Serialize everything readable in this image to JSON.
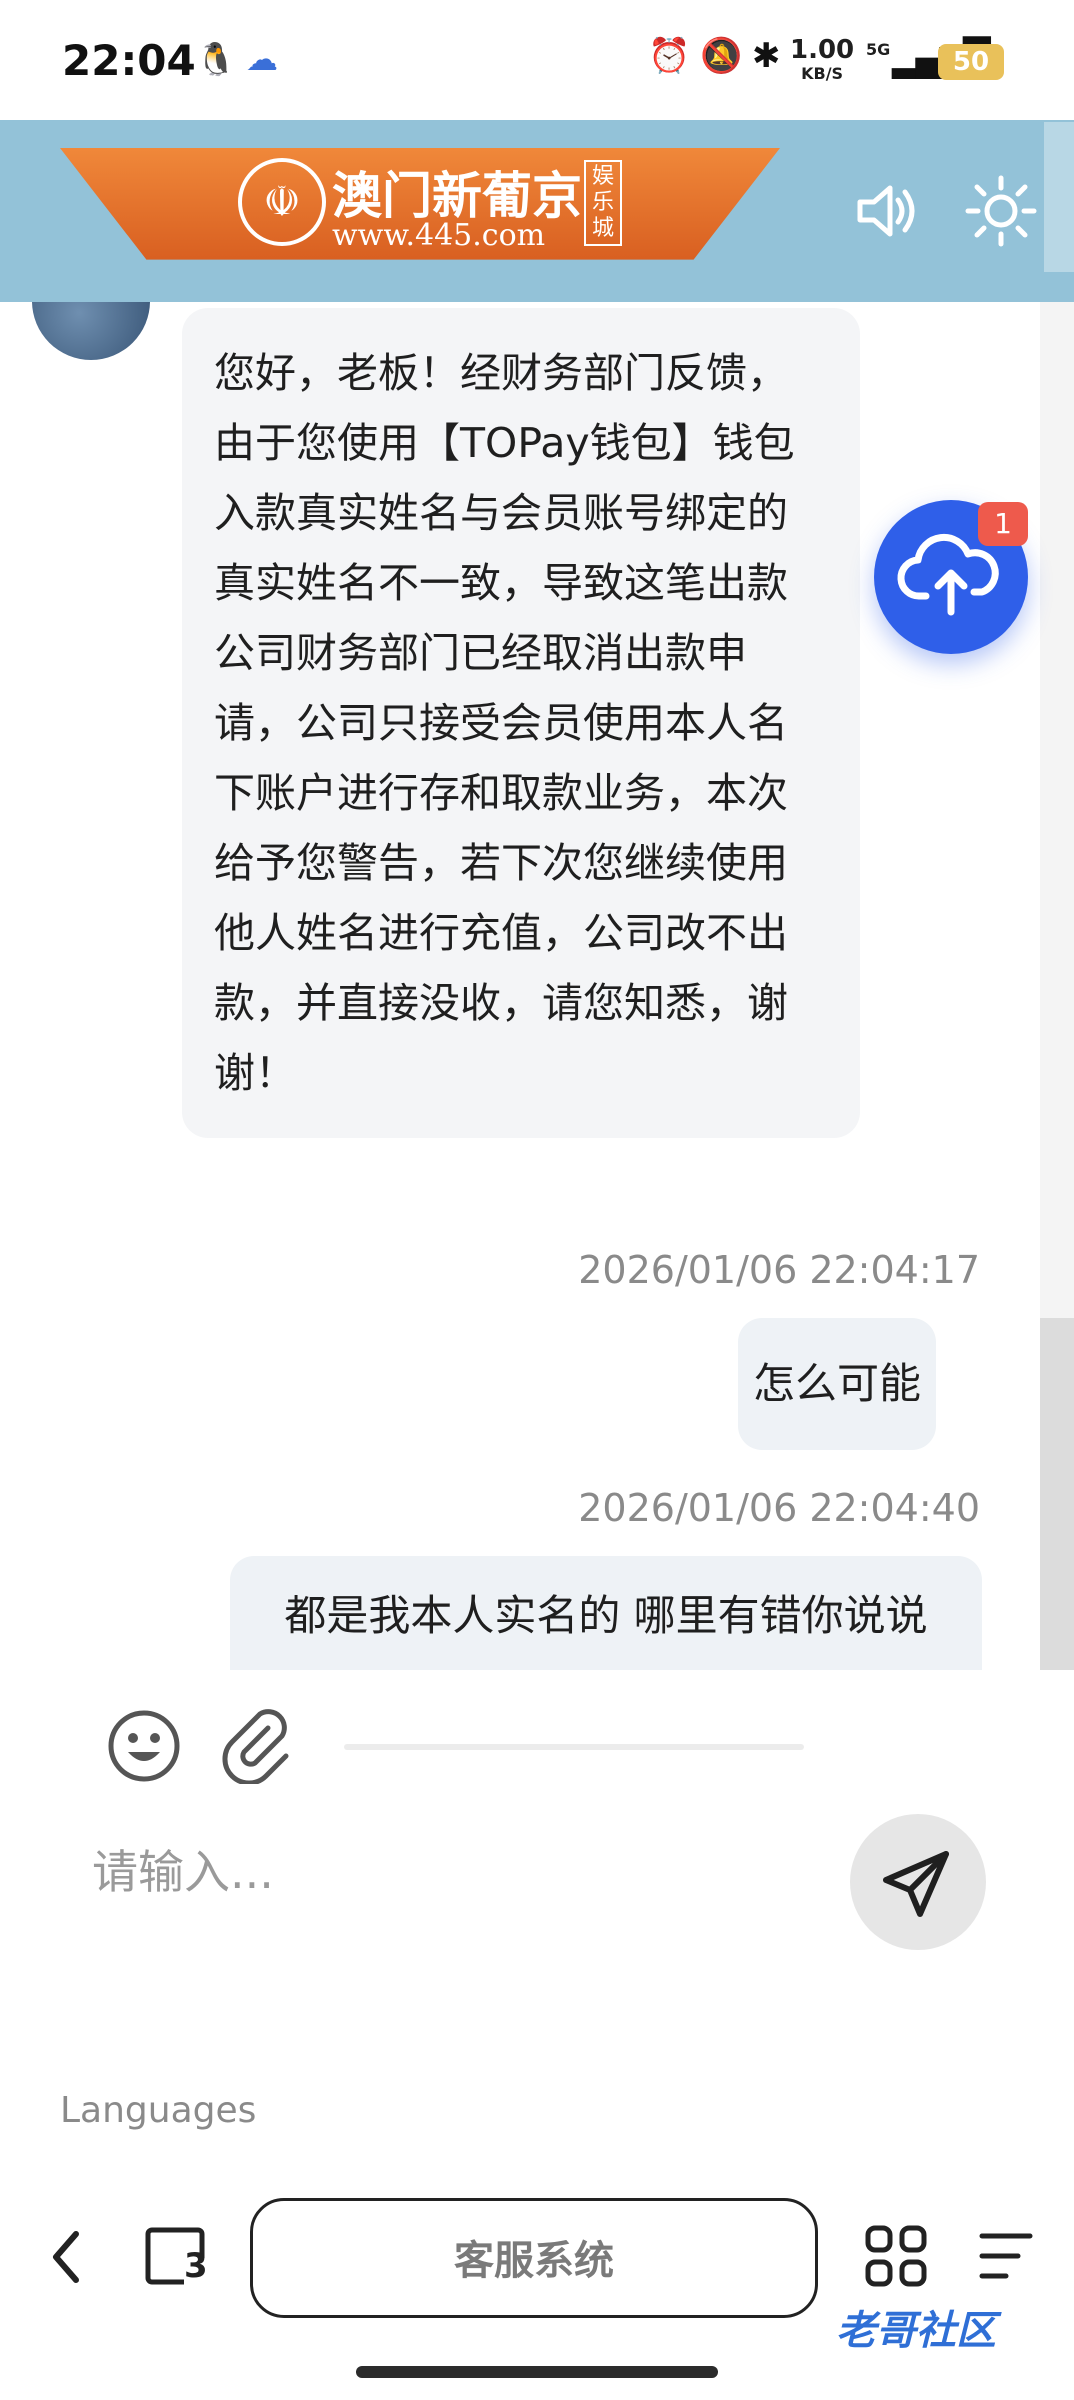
{
  "status_bar": {
    "time": "22:04",
    "net_speed_value": "1.00",
    "net_speed_unit": "KB/S",
    "network": "5G",
    "battery": "50",
    "icons": [
      "qq-icon",
      "cloud-icon",
      "alarm-icon",
      "mute-bell-icon",
      "bluetooth-icon",
      "signal-icon"
    ]
  },
  "header": {
    "banner_title": "澳门新葡京",
    "banner_url": "www.445.com",
    "banner_sub": "娱乐城",
    "logo_glyph": "☫"
  },
  "messages": [
    {
      "direction": "in",
      "text": "您好，老板！经财务部门反馈，由于您使用【TOPay钱包】钱包入款真实姓名与会员账号绑定的真实姓名不一致，导致这笔出款公司财务部门已经取消出款申请，公司只接受会员使用本人名下账户进行存和取款业务，本次给予您警告，若下次您继续使用他人姓名进行充值，公司改不出款，并直接没收，请您知悉，谢谢！"
    },
    {
      "direction": "out",
      "timestamp": "2026/01/06 22:04:17",
      "text": "怎么可能"
    },
    {
      "direction": "out",
      "timestamp": "2026/01/06 22:04:40",
      "text": "都是我本人实名的 哪里有错你说说"
    }
  ],
  "fab": {
    "badge": "1"
  },
  "input": {
    "placeholder": "请输入..."
  },
  "languages_label": "Languages",
  "browser": {
    "title": "客服系统",
    "tab_count": "3"
  },
  "watermark": "老哥社区",
  "colors": {
    "header_bg": "#93c2d8",
    "fab": "#2f5fe9",
    "badge": "#ee5a4c"
  }
}
